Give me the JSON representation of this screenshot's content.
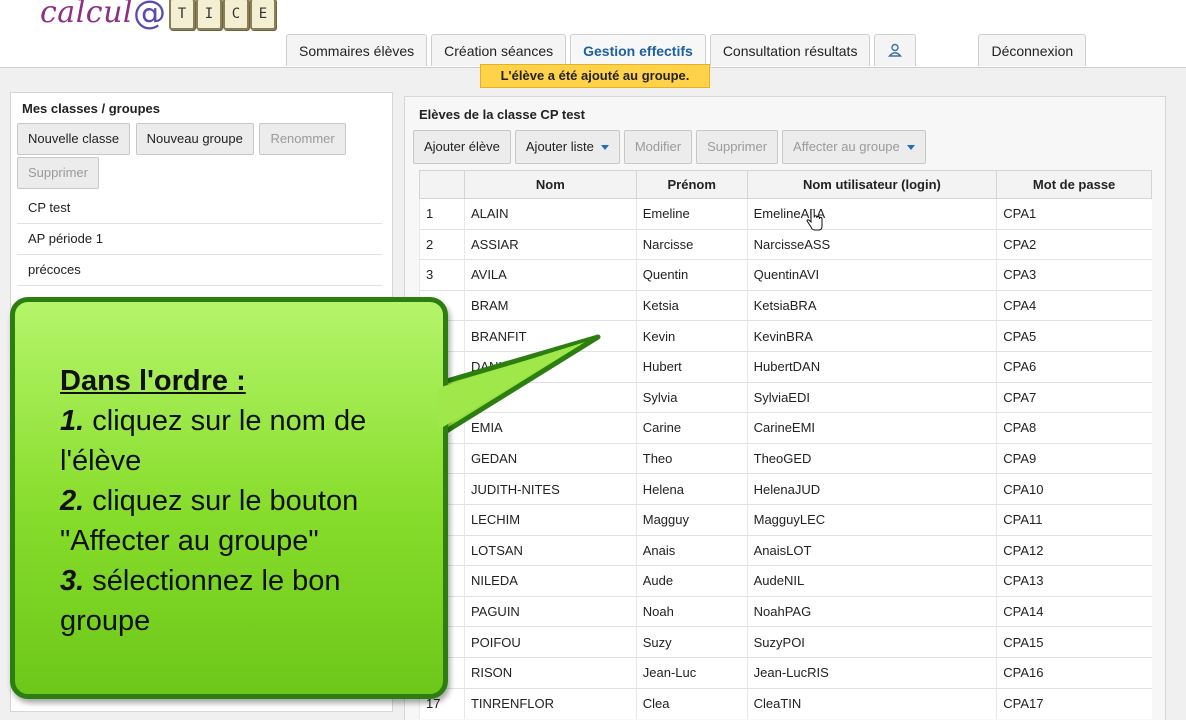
{
  "logo": {
    "text": "calcul",
    "at": "@",
    "tiles": [
      "T",
      "I",
      "C",
      "E"
    ]
  },
  "nav": {
    "tabs": [
      {
        "label": "Sommaires élèves"
      },
      {
        "label": "Création séances"
      },
      {
        "label": "Gestion effectifs"
      },
      {
        "label": "Consultation résultats"
      }
    ],
    "icon_tab": "user-icon",
    "logout_label": "Déconnexion"
  },
  "notice": "L'élève a été ajouté au groupe.",
  "left_panel": {
    "title": "Mes classes / groupes",
    "buttons": {
      "new_class": "Nouvelle classe",
      "new_group": "Nouveau groupe",
      "rename": "Renommer",
      "delete": "Supprimer"
    },
    "classes": [
      "CP test",
      "AP période 1",
      "précoces"
    ]
  },
  "right_panel": {
    "title": "Elèves de la classe CP test",
    "toolbar": {
      "add_student": "Ajouter élève",
      "add_list": "Ajouter liste",
      "modify": "Modifier",
      "delete": "Supprimer",
      "assign_group": "Affecter au groupe"
    },
    "table": {
      "headers": [
        "",
        "Nom",
        "Prénom",
        "Nom utilisateur (login)",
        "Mot de passe"
      ],
      "rows": [
        [
          "1",
          "ALAIN",
          "Emeline",
          "EmelineALA",
          "CPA1"
        ],
        [
          "2",
          "ASSIAR",
          "Narcisse",
          "NarcisseASS",
          "CPA2"
        ],
        [
          "3",
          "AVILA",
          "Quentin",
          "QuentinAVI",
          "CPA3"
        ],
        [
          "",
          "BRAM",
          "Ketsia",
          "KetsiaBRA",
          "CPA4"
        ],
        [
          "",
          "BRANFIT",
          "Kevin",
          "KevinBRA",
          "CPA5"
        ],
        [
          "",
          "DANLOR",
          "Hubert",
          "HubertDAN",
          "CPA6"
        ],
        [
          "",
          "",
          "Sylvia",
          "SylviaEDI",
          "CPA7"
        ],
        [
          "",
          "EMIA",
          "Carine",
          "CarineEMI",
          "CPA8"
        ],
        [
          "",
          "GEDAN",
          "Theo",
          "TheoGED",
          "CPA9"
        ],
        [
          "",
          "JUDITH-NITES",
          "Helena",
          "HelenaJUD",
          "CPA10"
        ],
        [
          "",
          "LECHIM",
          "Magguy",
          "MagguyLEC",
          "CPA11"
        ],
        [
          "",
          "LOTSAN",
          "Anais",
          "AnaisLOT",
          "CPA12"
        ],
        [
          "",
          "NILEDA",
          "Aude",
          "AudeNIL",
          "CPA13"
        ],
        [
          "",
          "PAGUIN",
          "Noah",
          "NoahPAG",
          "CPA14"
        ],
        [
          "",
          "POIFOU",
          "Suzy",
          "SuzyPOI",
          "CPA15"
        ],
        [
          "",
          "RISON",
          "Jean-Luc",
          "Jean-LucRIS",
          "CPA16"
        ],
        [
          "17",
          "TINRENFLOR",
          "Clea",
          "CleaTIN",
          "CPA17"
        ]
      ]
    }
  },
  "callout": {
    "heading": "Dans l'ordre :",
    "steps": [
      {
        "num": "1.",
        "text": " cliquez sur le nom de l'élève"
      },
      {
        "num": "2.",
        "text": " cliquez sur le bouton \"Affecter au groupe\""
      },
      {
        "num": "3.",
        "text": " sélectionnez le bon groupe"
      }
    ],
    "colors": {
      "fill": "#8fe036",
      "border": "#2c7e10"
    }
  }
}
